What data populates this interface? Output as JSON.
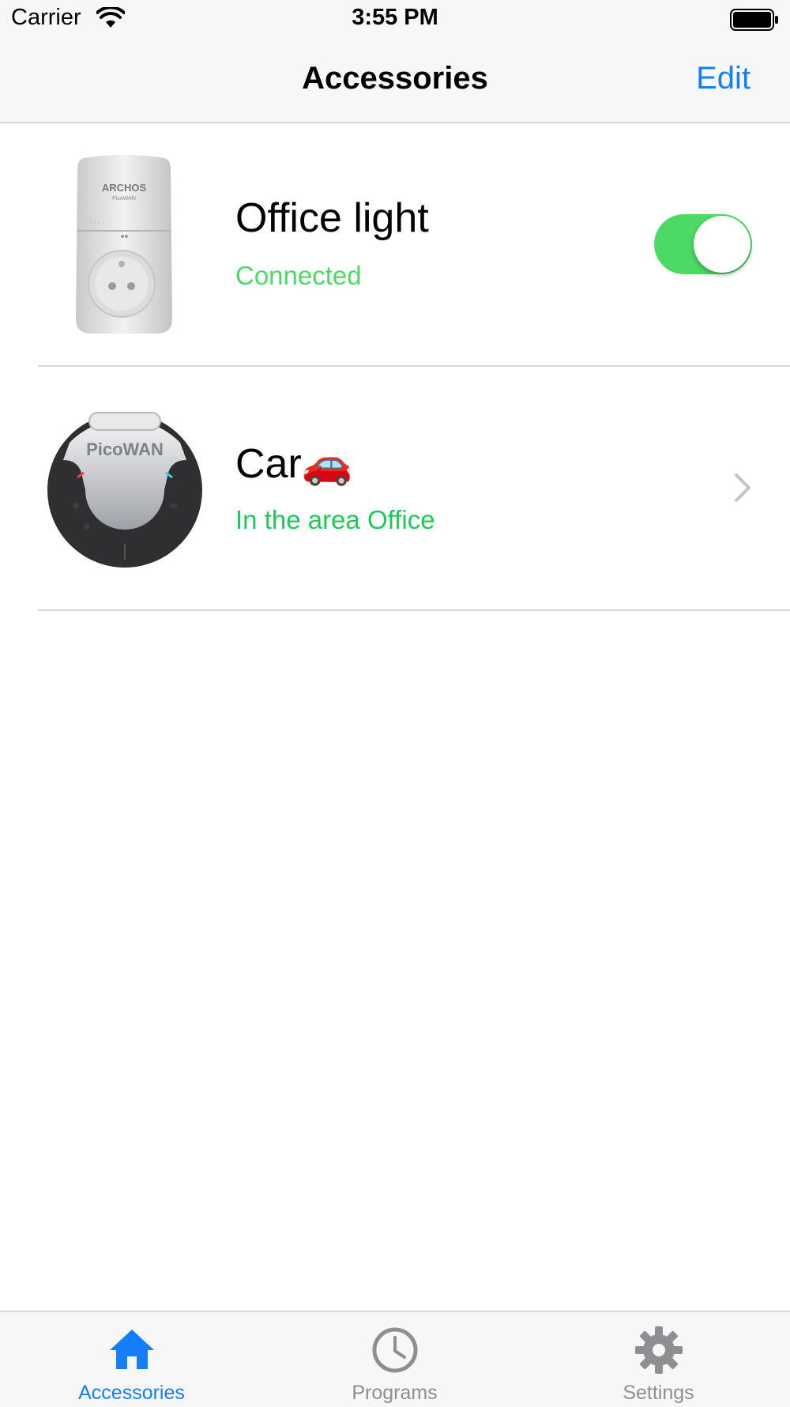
{
  "status_bar": {
    "carrier": "Carrier",
    "time": "3:55 PM"
  },
  "nav": {
    "title": "Accessories",
    "edit_label": "Edit"
  },
  "accessories": [
    {
      "name": "Office light",
      "status": "Connected",
      "status_color": "#4cd964",
      "image": "smart-plug-image",
      "image_text": "ARCHOS",
      "image_subtext": "PicoWAN",
      "toggle_on": true
    },
    {
      "name": "Car🚗",
      "status": "In the area Office",
      "status_color": "#1ec95a",
      "image": "tracker-tag-image",
      "image_text": "PicoWAN"
    }
  ],
  "tabs": [
    {
      "label": "Accessories",
      "icon": "home-icon",
      "active": true
    },
    {
      "label": "Programs",
      "icon": "clock-icon",
      "active": false
    },
    {
      "label": "Settings",
      "icon": "gear-icon",
      "active": false
    }
  ],
  "colors": {
    "accent": "#157efb",
    "inactive": "#8e8e93",
    "switch_on": "#4cd964"
  }
}
